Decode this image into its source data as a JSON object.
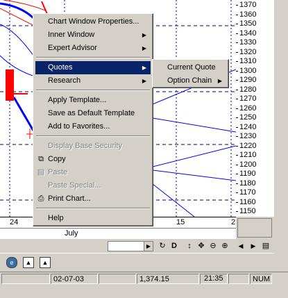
{
  "chart": {
    "y_ticks": [
      "1370",
      "1360",
      "1350",
      "1340",
      "1330",
      "1320",
      "1310",
      "1300",
      "1290",
      "1280",
      "1270",
      "1260",
      "1250",
      "1240",
      "1230",
      "1220",
      "1210",
      "1200",
      "1190",
      "1180",
      "1170",
      "1160",
      "1150"
    ],
    "x_ticks": [
      "24",
      "15",
      "2"
    ],
    "month_label": "July"
  },
  "menu": {
    "items": [
      {
        "label": "Chart Window Properties...",
        "submenu": false,
        "enabled": true
      },
      {
        "label": "Inner Window",
        "submenu": true,
        "enabled": true
      },
      {
        "label": "Expert Advisor",
        "submenu": true,
        "enabled": true
      },
      {
        "label": "Quotes",
        "submenu": true,
        "enabled": true,
        "selected": true
      },
      {
        "label": "Research",
        "submenu": true,
        "enabled": true
      },
      {
        "label": "Apply Template...",
        "submenu": false,
        "enabled": true
      },
      {
        "label": "Save as Default Template",
        "submenu": false,
        "enabled": true
      },
      {
        "label": "Add to Favorites...",
        "submenu": false,
        "enabled": true
      },
      {
        "label": "Display Base Security",
        "submenu": false,
        "enabled": false
      },
      {
        "label": "Copy",
        "submenu": false,
        "enabled": true,
        "icon": "copy-icon"
      },
      {
        "label": "Paste",
        "submenu": false,
        "enabled": false,
        "icon": "paste-icon"
      },
      {
        "label": "Paste Special...",
        "submenu": false,
        "enabled": false
      },
      {
        "label": "Print Chart...",
        "submenu": false,
        "enabled": true,
        "icon": "printer-icon"
      },
      {
        "label": "Help",
        "submenu": false,
        "enabled": true
      }
    ],
    "submenu": [
      {
        "label": "Current Quote",
        "submenu": false
      },
      {
        "label": "Option Chain",
        "submenu": true
      }
    ]
  },
  "chart_toolbar": {
    "icons": [
      "refresh-icon",
      "d-icon",
      "up-down-icon",
      "crosshair-icon",
      "zoom-out-icon",
      "zoom-in-icon",
      "scroll-left-icon",
      "scroll-right-icon",
      "window-icon"
    ],
    "labels": {
      "refresh": "↻",
      "d": "D",
      "updown": "↕",
      "cross": "✥",
      "zoomout": "⊖",
      "zoomin": "⊕",
      "left": "◀",
      "right": "▶",
      "win": "▤"
    }
  },
  "status": {
    "date": "02-07-03",
    "price": "1,374.15",
    "time": "21:35",
    "num": "NUM"
  },
  "colors": {
    "menu_highlight": "#0a246a",
    "grid_dash": "#000080",
    "series_blue": "#0000ff",
    "series_red": "#ff0000"
  }
}
